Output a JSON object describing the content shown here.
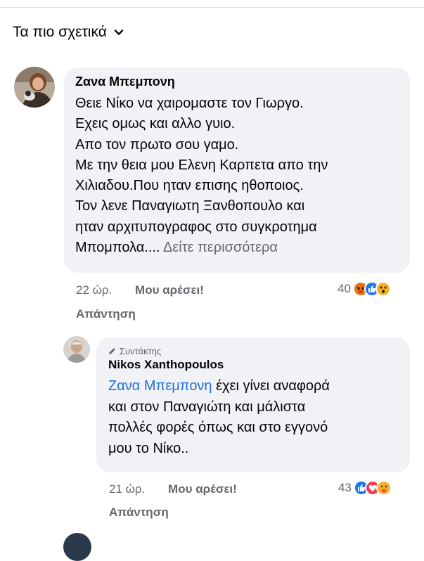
{
  "sort": {
    "label": "Τα πιο σχετικά"
  },
  "comment1": {
    "author": "Ζανα Μπεμπονη",
    "lines": [
      "Θειε Νίκο να χαιρομαστε τον Γιωργο.",
      "Εχεις ομως και αλλο γυιο.",
      "Απο τον πρωτο σου γαμο.",
      "Με την θεια μου Ελενη Καρπετα απο την",
      "Χιλιαδου.Που ηταν επισης ηθοποιος.",
      "Τον λενε Παναγιωτη Ξανθοπουλο και",
      "ηταν αρχιτυπογραφος στο συγκροτημα",
      "Μπομπολα...."
    ],
    "see_more": "Δείτε περισσότερα",
    "time": "22 ώρ.",
    "like": "Μου αρέσει!",
    "reply": "Απάντηση",
    "reaction_count": "40",
    "reactions": [
      "angry-icon",
      "like-icon",
      "wow-icon"
    ]
  },
  "comment2": {
    "author_badge": "Συντάκτης",
    "author": "Nikos Xanthopoulos",
    "mention": "Ζανα Μπεμπονη",
    "line1_rest": " έχει γίνει αναφορά",
    "lines": [
      "και στον Παναγιώτη και μάλιστα",
      "πολλές φορές όπως και στο εγγονό",
      "μου το Νίκο.."
    ],
    "time": "21 ώρ.",
    "like": "Μου αρέσει!",
    "reply": "Απάντηση",
    "reaction_count": "43",
    "reactions": [
      "like-icon",
      "love-icon",
      "care-icon"
    ]
  },
  "colors": {
    "bubble": "#f0f2f5",
    "mention": "#216fdb",
    "secondary": "#65676b",
    "like_blue": "#1877f2",
    "love_red": "#f33e58",
    "angry_orange": "#e9710f",
    "wow_yellow": "#f7b125"
  }
}
